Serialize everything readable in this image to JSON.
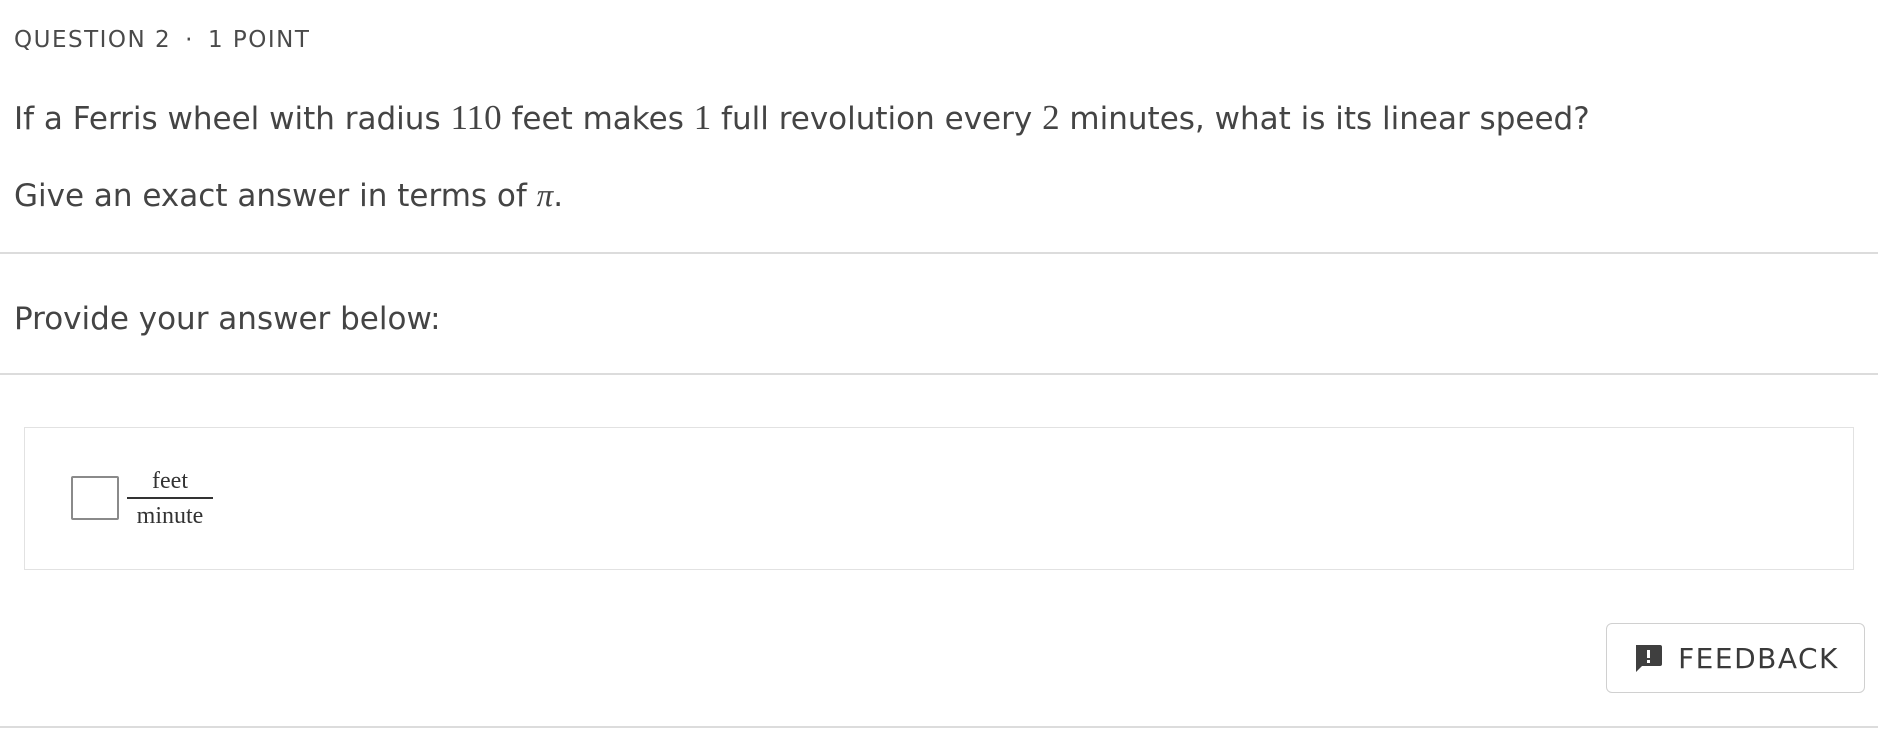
{
  "header": {
    "question_label": "QUESTION 2",
    "separator": "·",
    "points": "1 POINT"
  },
  "question": {
    "text_part1": "If a Ferris wheel with radius ",
    "radius": "110",
    "text_part2": " feet makes ",
    "revolutions": "1",
    "text_part3": " full revolution every ",
    "minutes": "2",
    "text_part4": " minutes, what is its linear speed?",
    "instruction_text": "Give an exact answer in terms of ",
    "pi_symbol": "π",
    "instruction_end": "."
  },
  "answer": {
    "provide_label": "Provide your answer below:",
    "input_value": "",
    "unit_numerator": "feet",
    "unit_denominator": "minute"
  },
  "feedback": {
    "label": "FEEDBACK",
    "icon": "feedback-icon"
  }
}
